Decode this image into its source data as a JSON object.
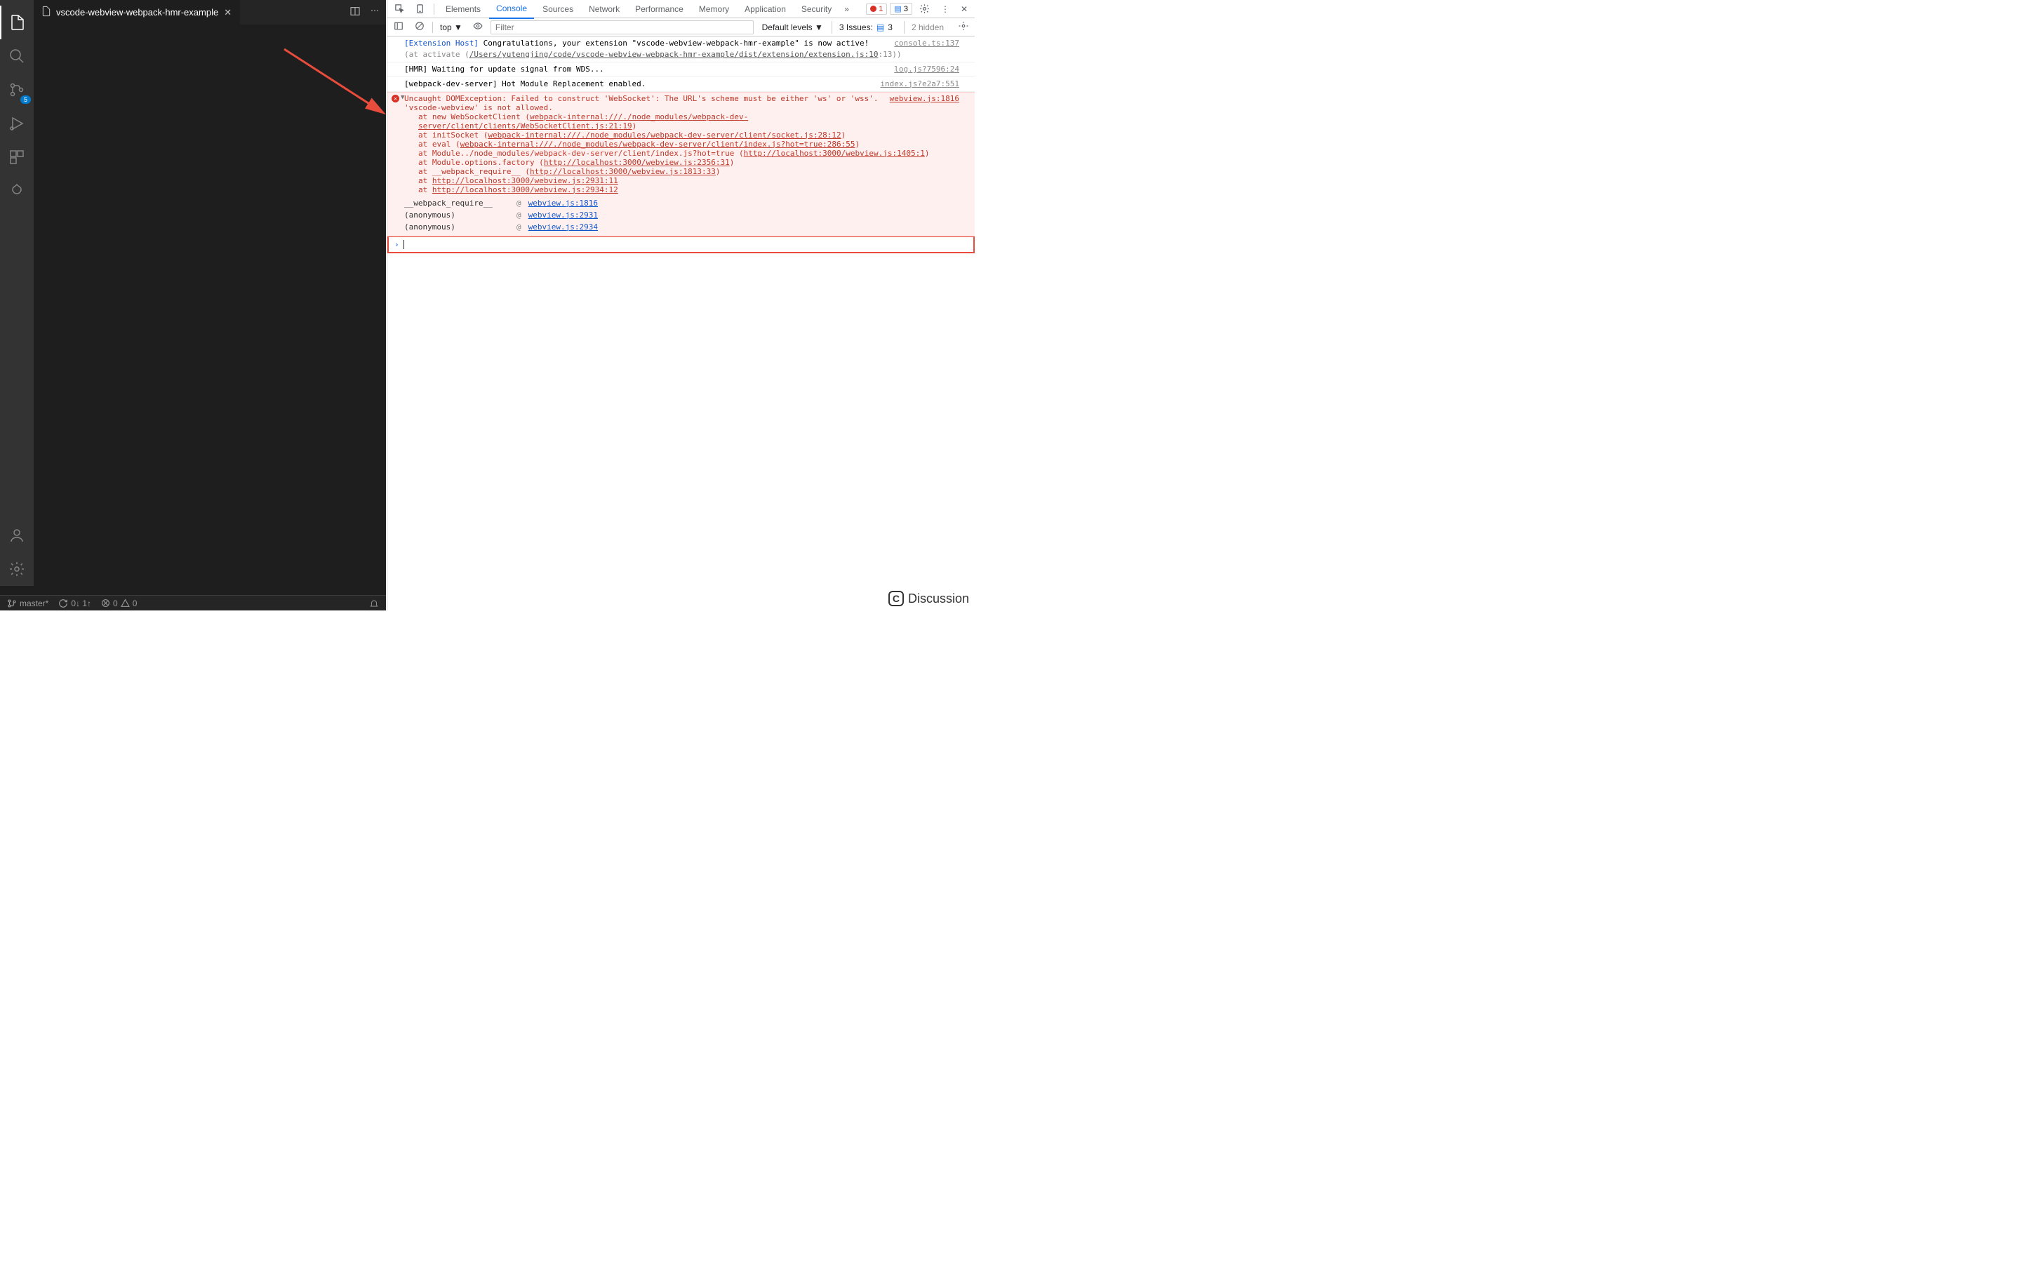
{
  "vscode": {
    "tab_title": "vscode-webview-webpack-hmr-example",
    "scm_badge": "5",
    "status": {
      "branch": "master*",
      "sync": "0↓ 1↑",
      "errors": "0",
      "warnings": "0"
    }
  },
  "devtools": {
    "tabs": [
      "Elements",
      "Console",
      "Sources",
      "Network",
      "Performance",
      "Memory",
      "Application",
      "Security"
    ],
    "active_tab": "Console",
    "err_pill": "1",
    "info_pill": "3",
    "toolbar": {
      "context": "top",
      "filter_placeholder": "Filter",
      "levels": "Default levels",
      "issues_label": "3 Issues:",
      "issues_count": "3",
      "hidden": "2 hidden"
    },
    "logs": [
      {
        "type": "info",
        "prefix": "[Extension Host]",
        "msg": "Congratulations, your extension \"vscode-webview-webpack-hmr-example\" is now active!",
        "sub_prefix": "(at activate (",
        "sub_link": "/Users/yutengjing/code/vscode-webview-webpack-hmr-example/dist/extension/extension.js:10",
        "sub_suffix": ":13))",
        "src": "console.ts:137"
      },
      {
        "type": "plain",
        "msg": "[HMR] Waiting for update signal from WDS...",
        "src": "log.js?7596:24"
      },
      {
        "type": "plain",
        "msg": "[webpack-dev-server] Hot Module Replacement enabled.",
        "src": "index.js?e2a7:551"
      }
    ],
    "error": {
      "src": "webview.js:1816",
      "head1": "Uncaught DOMException: Failed to construct 'WebSocket': The URL's scheme must be either 'ws' or 'wss'.",
      "head2": "'vscode-webview' is not allowed.",
      "stack": [
        {
          "at": "at new WebSocketClient (",
          "link": "webpack-internal:///./node_modules/webpack-dev-server/client/clients/WebSocketClient.js:21:19",
          "end": ")"
        },
        {
          "at": "at initSocket (",
          "link": "webpack-internal:///./node_modules/webpack-dev-server/client/socket.js:28:12",
          "end": ")"
        },
        {
          "at": "at eval (",
          "link": "webpack-internal:///./node_modules/webpack-dev-server/client/index.js?hot=true:286:55",
          "end": ")"
        },
        {
          "at": "at Module../node_modules/webpack-dev-server/client/index.js?hot=true (",
          "link": "http://localhost:3000/webview.js:1405:1",
          "end": ")"
        },
        {
          "at": "at Module.options.factory (",
          "link": "http://localhost:3000/webview.js:2356:31",
          "end": ")"
        },
        {
          "at": "at __webpack_require__ (",
          "link": "http://localhost:3000/webview.js:1813:33",
          "end": ")"
        },
        {
          "at": "at ",
          "link": "http://localhost:3000/webview.js:2931:11",
          "end": ""
        },
        {
          "at": "at ",
          "link": "http://localhost:3000/webview.js:2934:12",
          "end": ""
        }
      ],
      "calls": [
        {
          "fn": "__webpack_require__",
          "at": "@",
          "loc": "webview.js:1816"
        },
        {
          "fn": "(anonymous)",
          "at": "@",
          "loc": "webview.js:2931"
        },
        {
          "fn": "(anonymous)",
          "at": "@",
          "loc": "webview.js:2934"
        }
      ]
    }
  },
  "discussion": "Discussion"
}
